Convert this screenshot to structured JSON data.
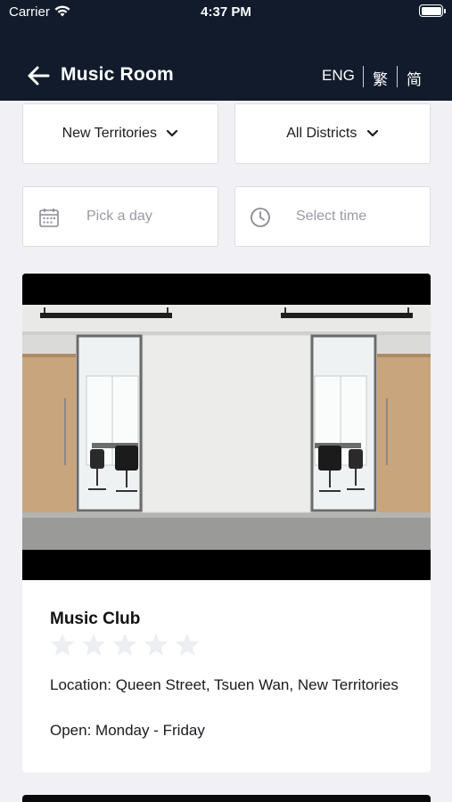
{
  "status_bar": {
    "carrier": "Carrier",
    "time": "4:37 PM"
  },
  "header": {
    "title": "Music Room",
    "languages": [
      "ENG",
      "繁",
      "简"
    ]
  },
  "filters": {
    "region": "New Territories",
    "district": "All Districts",
    "date_placeholder": "Pick a day",
    "time_placeholder": "Select time"
  },
  "venue": {
    "name": "Music Club",
    "rating": 0,
    "rating_max": 5,
    "location": "Location: Queen Street, Tsuen Wan, New Territories",
    "open": "Open: Monday - Friday"
  },
  "colors": {
    "header_bg": "#111b2c",
    "page_bg": "#f0f0f5",
    "star_empty": "#eceef2"
  }
}
